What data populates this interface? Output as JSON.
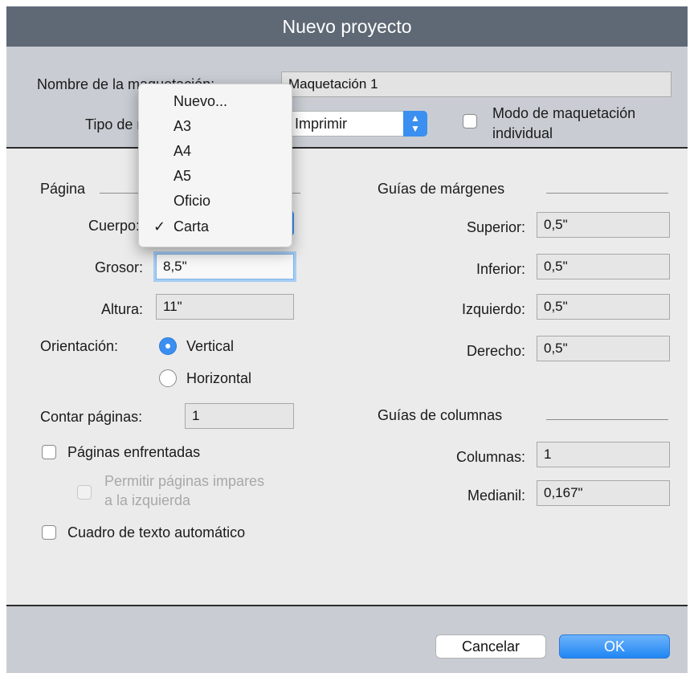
{
  "title": "Nuevo proyecto",
  "header": {
    "layout_name_label": "Nombre de la maquetación:",
    "layout_name_value": "Maquetación 1",
    "type_label": "Tipo de maquetación:",
    "type_value": "Imprimir",
    "individual_mode_label_line1": "Modo de maquetación",
    "individual_mode_label_line2": "individual",
    "individual_mode_checked": false
  },
  "page": {
    "section_label": "Página",
    "size_label": "Cuerpo:",
    "width_label": "Grosor:",
    "width_value": "8,5\"",
    "height_label": "Altura:",
    "height_value": "11\"",
    "orientation_label": "Orientación:",
    "orientation_options": [
      "Vertical",
      "Horizontal"
    ],
    "orientation_selected": "Vertical",
    "page_count_label": "Contar páginas:",
    "page_count_value": "1",
    "facing_pages_label": "Páginas enfrentadas",
    "allow_odd_left_line1": "Permitir páginas impares",
    "allow_odd_left_line2": "a la izquierda",
    "auto_text_box_label": "Cuadro de texto automático"
  },
  "margins": {
    "section_label": "Guías de márgenes",
    "top_label": "Superior:",
    "top_value": "0,5\"",
    "bottom_label": "Inferior:",
    "bottom_value": "0,5\"",
    "left_label": "Izquierdo:",
    "left_value": "0,5\"",
    "right_label": "Derecho:",
    "right_value": "0,5\""
  },
  "columns": {
    "section_label": "Guías de columnas",
    "columns_label": "Columnas:",
    "columns_value": "1",
    "gutter_label": "Medianil:",
    "gutter_value": "0,167\""
  },
  "size_menu": {
    "items": [
      "Nuevo...",
      "A3",
      "A4",
      "A5",
      "Oficio",
      "Carta"
    ],
    "selected": "Carta",
    "check_mark": "✓"
  },
  "footer": {
    "cancel_label": "Cancelar",
    "ok_label": "OK"
  },
  "colors": {
    "accent": "#3b8ff0",
    "title_bar": "#5f6875",
    "header_bg": "#c9cdd3"
  }
}
